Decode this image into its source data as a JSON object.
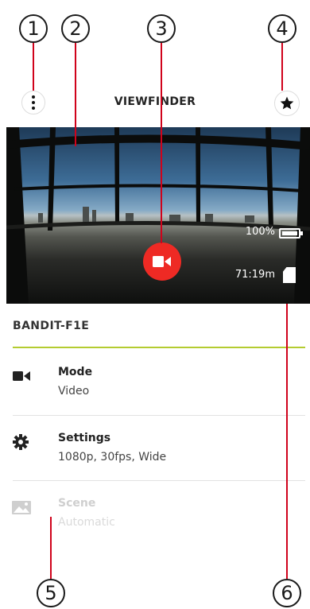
{
  "header": {
    "title": "VIEWFINDER"
  },
  "viewfinder": {
    "battery_text": "100%",
    "remaining_time": "71:19m"
  },
  "device": {
    "name": "BANDIT-F1E"
  },
  "rows": [
    {
      "title": "Mode",
      "value": "Video",
      "icon": "video-camera-icon",
      "enabled": true
    },
    {
      "title": "Settings",
      "value": "1080p, 30fps, Wide",
      "icon": "gear-icon",
      "enabled": true
    },
    {
      "title": "Scene",
      "value": "Automatic",
      "icon": "image-icon",
      "enabled": false
    }
  ],
  "callouts": [
    "1",
    "2",
    "3",
    "4",
    "5",
    "6"
  ],
  "colors": {
    "record": "#ee2a24",
    "accent_rule": "#b4cc30",
    "callout_line": "#d0021b"
  }
}
